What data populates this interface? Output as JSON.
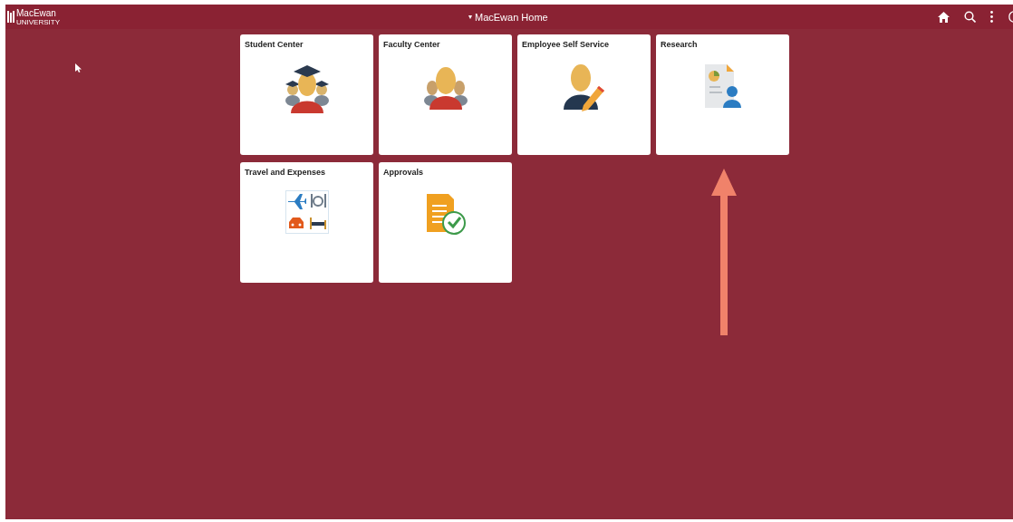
{
  "header": {
    "logo_name": "MacEwan",
    "logo_sub": "UNIVERSITY",
    "caret": "▾",
    "title": "MacEwan Home"
  },
  "tiles": [
    {
      "title": "Student Center",
      "kind": "student"
    },
    {
      "title": "Faculty Center",
      "kind": "faculty"
    },
    {
      "title": "Employee Self Service",
      "kind": "employee"
    },
    {
      "title": "Research",
      "kind": "research"
    },
    {
      "title": "Travel and Expenses",
      "kind": "travel"
    },
    {
      "title": "Approvals",
      "kind": "approvals"
    }
  ]
}
